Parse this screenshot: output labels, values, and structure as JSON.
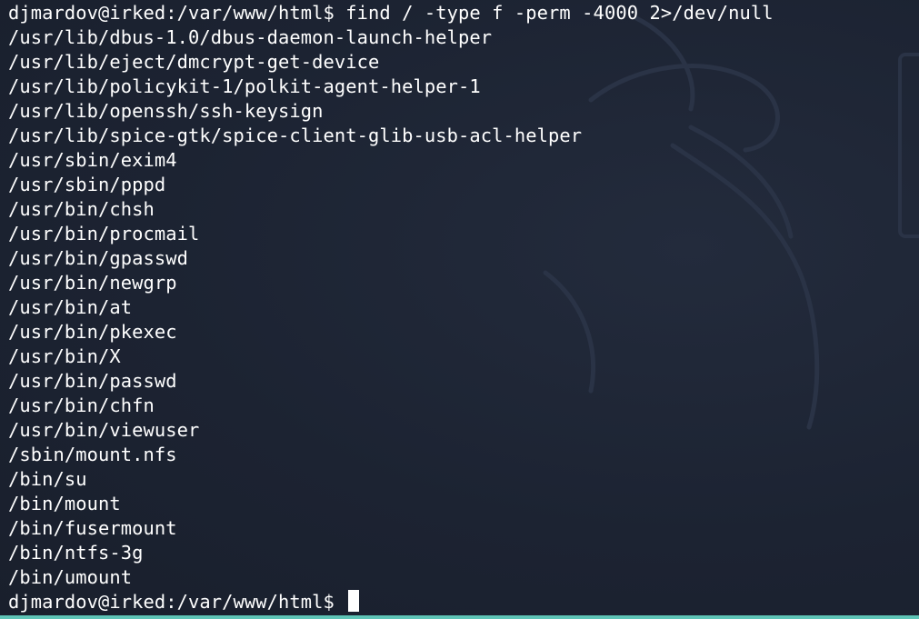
{
  "terminal": {
    "command_line": "djmardov@irked:/var/www/html$ find / -type f -perm -4000 2>/dev/null",
    "output": [
      "/usr/lib/dbus-1.0/dbus-daemon-launch-helper",
      "/usr/lib/eject/dmcrypt-get-device",
      "/usr/lib/policykit-1/polkit-agent-helper-1",
      "/usr/lib/openssh/ssh-keysign",
      "/usr/lib/spice-gtk/spice-client-glib-usb-acl-helper",
      "/usr/sbin/exim4",
      "/usr/sbin/pppd",
      "/usr/bin/chsh",
      "/usr/bin/procmail",
      "/usr/bin/gpasswd",
      "/usr/bin/newgrp",
      "/usr/bin/at",
      "/usr/bin/pkexec",
      "/usr/bin/X",
      "/usr/bin/passwd",
      "/usr/bin/chfn",
      "/usr/bin/viewuser",
      "/sbin/mount.nfs",
      "/bin/su",
      "/bin/mount",
      "/bin/fusermount",
      "/bin/ntfs-3g",
      "/bin/umount"
    ],
    "prompt": "djmardov@irked:/var/www/html$ "
  },
  "colors": {
    "background": "#1c2332",
    "foreground": "#ffffff",
    "status_bar": "#5ec4b6"
  },
  "icons": {
    "watermark": "kali-dragon-icon",
    "cursor": "block-cursor"
  }
}
